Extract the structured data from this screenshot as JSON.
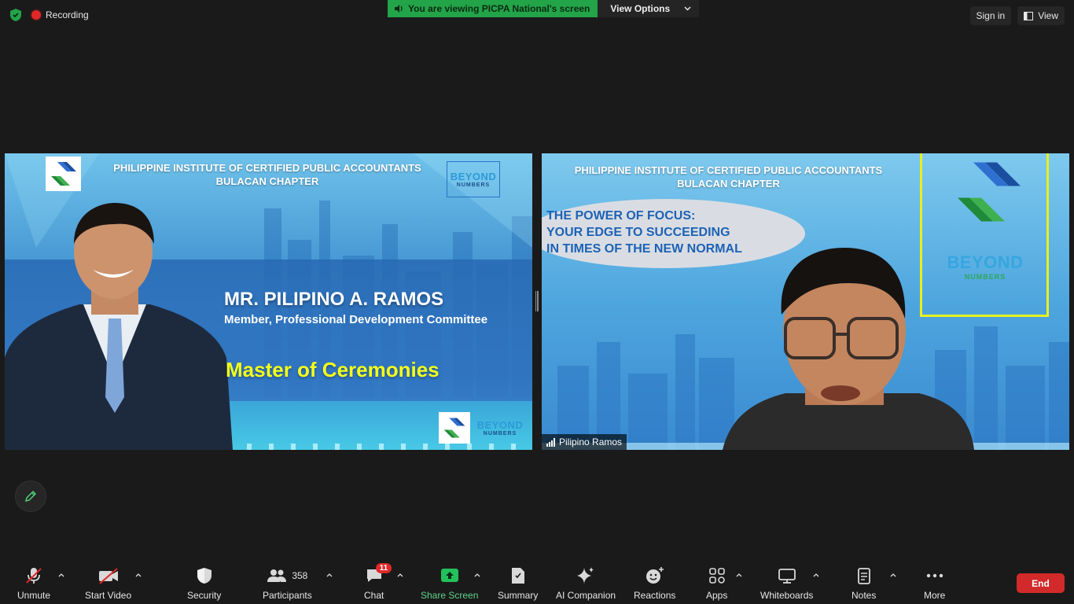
{
  "status": {
    "recording": "Recording"
  },
  "share_banner": {
    "text": "You are viewing PICPA National's screen",
    "options": "View Options"
  },
  "top_right": {
    "sign_in": "Sign in",
    "view": "View"
  },
  "left_slide": {
    "header_line1": "PHILIPPINE INSTITUTE OF CERTIFIED PUBLIC ACCOUNTANTS",
    "header_line2": "BULACAN CHAPTER",
    "logo_text1": "BEYOND",
    "logo_text2": "NUMBERS",
    "name": "MR. PILIPINO A. RAMOS",
    "role": "Member, Professional Development Committee",
    "title": "Master of Ceremonies"
  },
  "right_tile": {
    "header_line1": "PHILIPPINE INSTITUTE OF CERTIFIED PUBLIC ACCOUNTANTS",
    "header_line2": "BULACAN CHAPTER",
    "topic_line1": "THE POWER OF FOCUS:",
    "topic_line2": "YOUR EDGE TO SUCCEEDING",
    "topic_line3": "IN TIMES OF THE NEW NORMAL",
    "logo_text1": "BEYOND",
    "logo_text2": "NUMBERS",
    "participant_name": "Pilipino Ramos"
  },
  "toolbar": {
    "unmute": "Unmute",
    "start_video": "Start Video",
    "security": "Security",
    "participants": "Participants",
    "participants_count": "358",
    "chat": "Chat",
    "chat_badge": "11",
    "share_screen": "Share Screen",
    "summary": "Summary",
    "ai_companion": "AI Companion",
    "reactions": "Reactions",
    "apps": "Apps",
    "whiteboards": "Whiteboards",
    "notes": "Notes",
    "more": "More",
    "end": "End"
  },
  "colors": {
    "background": "#1a1a1a",
    "share_green": "#23a449",
    "end_red": "#d22a2a",
    "mc_yellow": "#f5ff1a",
    "topic_blue": "#1d62b5"
  }
}
